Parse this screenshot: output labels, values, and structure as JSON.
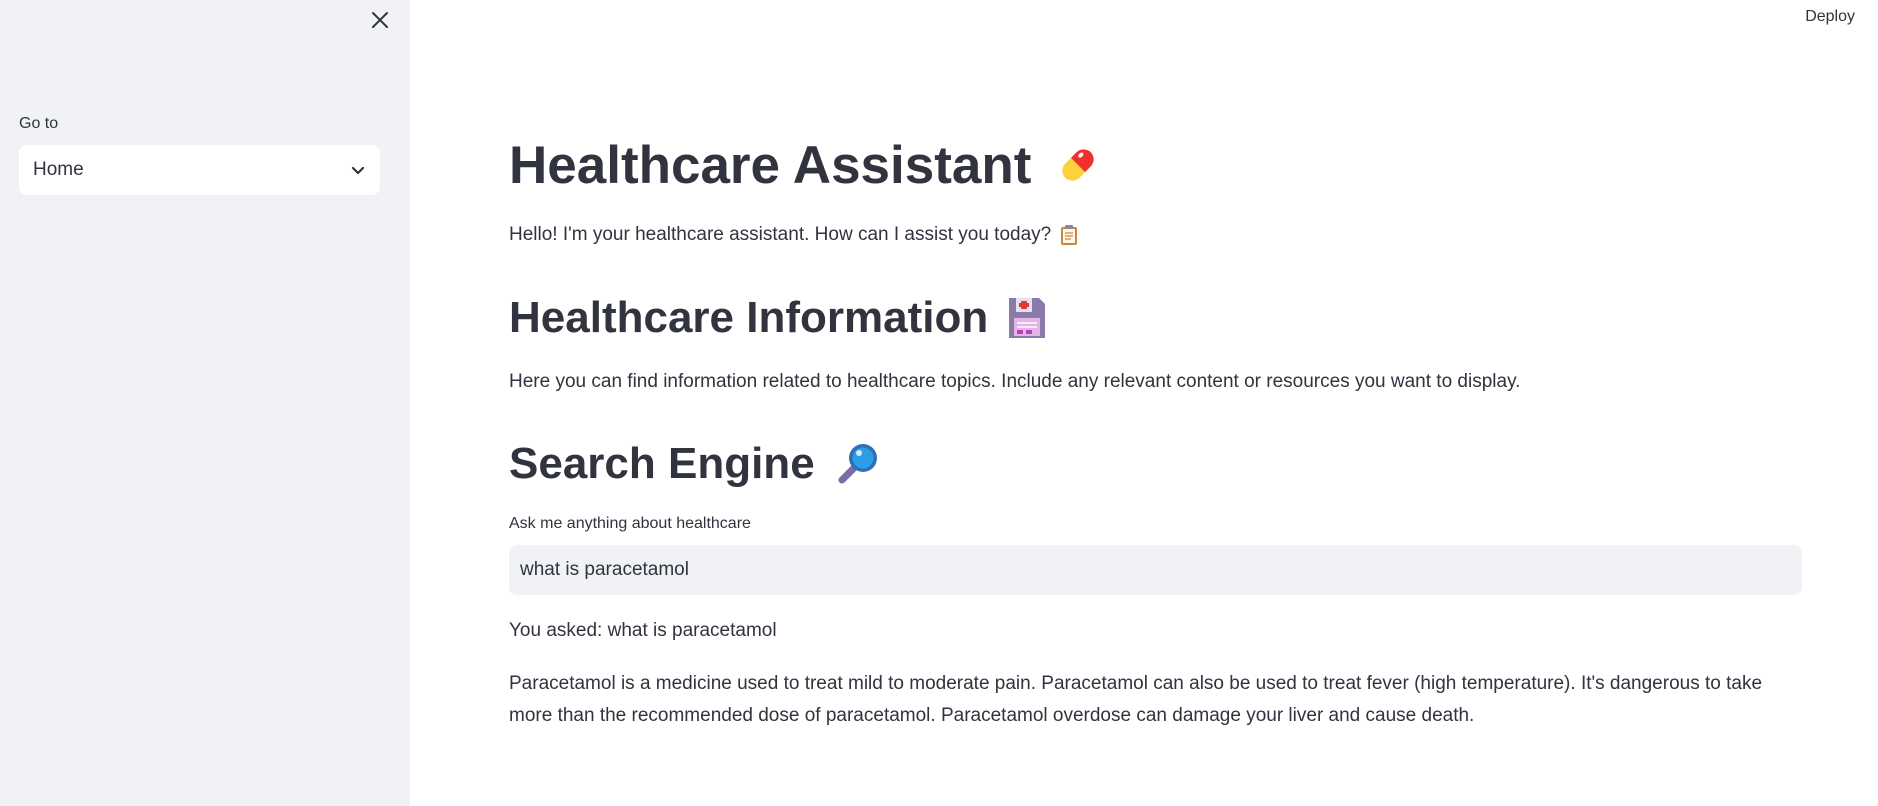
{
  "header": {
    "deploy_label": "Deploy"
  },
  "sidebar": {
    "nav_label": "Go to",
    "nav_selected": "Home"
  },
  "main": {
    "title": "Healthcare Assistant",
    "title_icon": "pill-icon",
    "greeting": "Hello! I'm your healthcare assistant. How can I assist you today?",
    "greeting_icon": "clipboard-icon",
    "info_heading": "Healthcare Information",
    "info_icon": "floppy-disk-icon",
    "info_text": "Here you can find information related to healthcare topics. Include any relevant content or resources you want to display.",
    "search_heading": "Search Engine",
    "search_icon": "magnifying-glass-icon",
    "search_label": "Ask me anything about healthcare",
    "search_value": "what is paracetamol",
    "you_asked": "You asked: what is paracetamol",
    "answer": "Paracetamol is a medicine used to treat mild to moderate pain. Paracetamol can also be used to treat fever (high temperature). It's dangerous to take more than the recommended dose of paracetamol. Paracetamol overdose can damage your liver and cause death."
  },
  "colors": {
    "sidebar_bg": "#f0f2f6",
    "text": "#31333f",
    "input_bg": "#f0f2f6"
  }
}
